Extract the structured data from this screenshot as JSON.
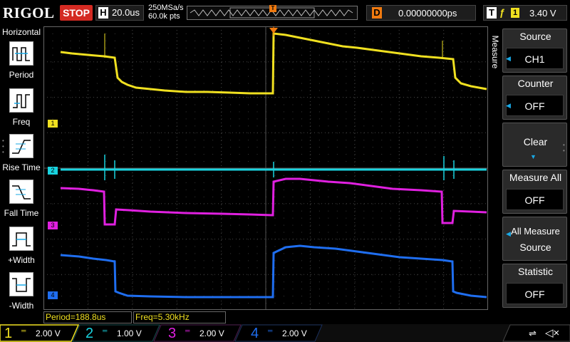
{
  "top_bar": {
    "brand": "RIGOL",
    "run_state": "STOP",
    "horizontal": {
      "letter": "H",
      "timebase": "20.0us"
    },
    "sample_rate": "250MSa/s",
    "memory_depth": "60.0k pts",
    "trigger_pos_marker": "T",
    "delay": {
      "letter": "D",
      "value": "0.00000000ps"
    },
    "trigger": {
      "letter": "T",
      "edge": "ƒ",
      "source": "1",
      "level": "3.40 V"
    }
  },
  "left_menu": {
    "title": "Horizontal",
    "items": [
      {
        "label": "Period",
        "icon": "period-icon"
      },
      {
        "label": "Freq",
        "icon": "freq-icon"
      },
      {
        "label": "Rise Time",
        "icon": "rise-time-icon"
      },
      {
        "label": "Fall Time",
        "icon": "fall-time-icon"
      },
      {
        "label": "+Width",
        "icon": "positive-width-icon"
      },
      {
        "label": "-Width",
        "icon": "negative-width-icon"
      }
    ]
  },
  "right_menu": {
    "tab": "Measure",
    "source": {
      "title": "Source",
      "value": "CH1"
    },
    "counter": {
      "title": "Counter",
      "value": "OFF"
    },
    "clear": {
      "title": "Clear"
    },
    "measure_all": {
      "title": "Measure All",
      "value": "OFF"
    },
    "all_measure_source": {
      "title_line1": "All Measure",
      "title_line2": "Source"
    },
    "statistic": {
      "title": "Statistic",
      "value": "OFF"
    }
  },
  "measurements": [
    {
      "text": "Period=188.8us"
    },
    {
      "text": "Freq=5.30kHz"
    }
  ],
  "channels": [
    {
      "number": "1",
      "scale": "2.00 V",
      "color": "#f0e020",
      "active": true
    },
    {
      "number": "2",
      "scale": "1.00 V",
      "color": "#19d3df",
      "active": false
    },
    {
      "number": "3",
      "scale": "2.00 V",
      "color": "#e020e0",
      "active": false
    },
    {
      "number": "4",
      "scale": "2.00 V",
      "color": "#1f6ef0",
      "active": false
    }
  ],
  "channel_markers": [
    "1",
    "2",
    "3",
    "4"
  ],
  "colors": {
    "ch1": "#f0e020",
    "ch2": "#19d3df",
    "ch3": "#e020e0",
    "ch4": "#1f6ef0",
    "stop": "#d42a22",
    "trigger": "#f07a10",
    "grid": "#4a4a4a"
  }
}
